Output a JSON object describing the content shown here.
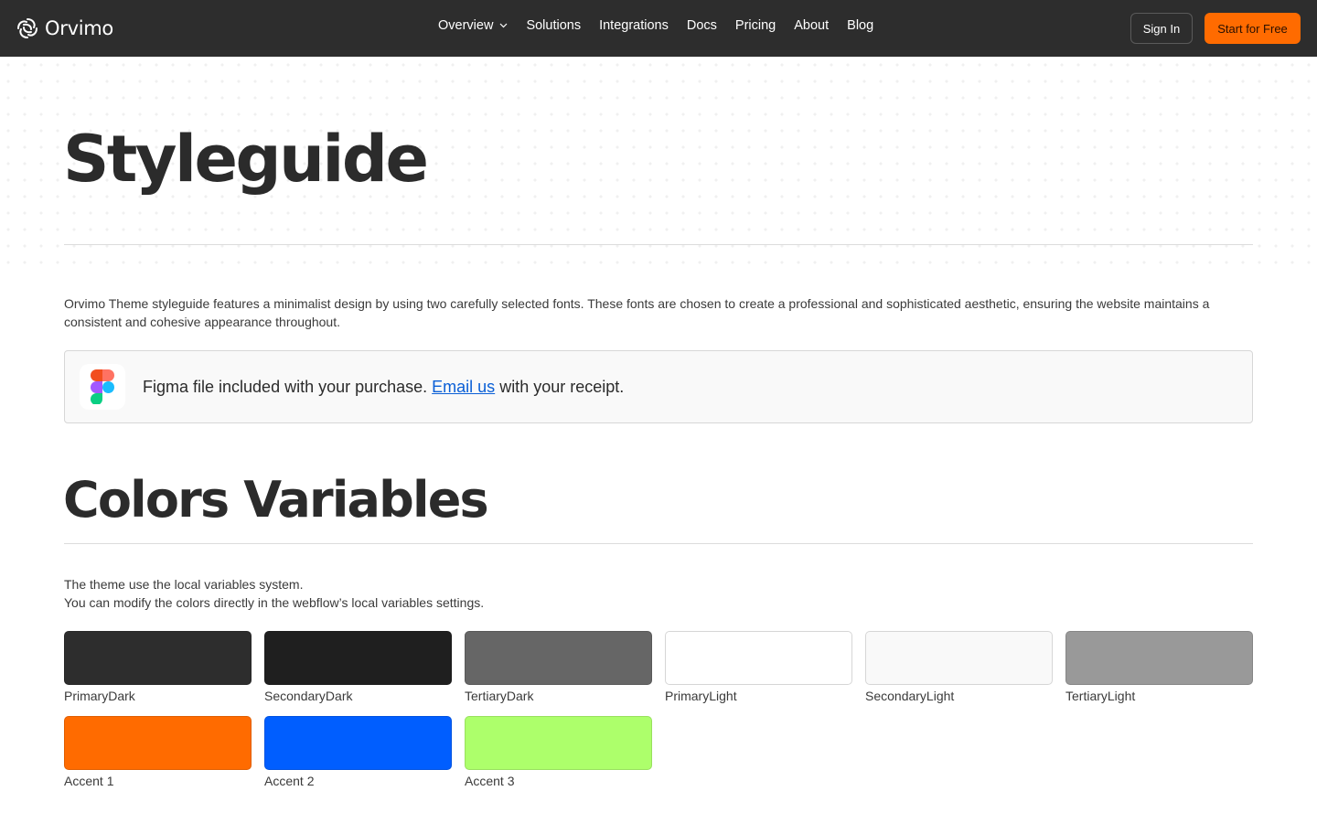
{
  "nav": {
    "brand": "Orvimo",
    "links": [
      "Overview",
      "Solutions",
      "Integrations",
      "Docs",
      "Pricing",
      "About",
      "Blog"
    ],
    "signin": "Sign In",
    "start": "Start for Free"
  },
  "hero": {
    "title": "Styleguide"
  },
  "intro": "Orvimo Theme styleguide features a minimalist design by using two carefully selected fonts. These fonts are chosen to create a professional and sophisticated aesthetic, ensuring the website maintains a consistent and cohesive appearance throughout.",
  "figma": {
    "text_before": "Figma file included with your purchase. ",
    "link": "Email us",
    "text_after": " with your receipt."
  },
  "colors_section": {
    "title": "Colors Variables",
    "desc_line1": "The theme use the local variables system.",
    "desc_line2": "You can modify the colors directly in the webflow’s local variables settings."
  },
  "swatches": [
    {
      "label": "PrimaryDark",
      "color": "#2d2d2d"
    },
    {
      "label": "SecondaryDark",
      "color": "#1f1f1f"
    },
    {
      "label": "TertiaryDark",
      "color": "#666666"
    },
    {
      "label": "PrimaryLight",
      "color": "#ffffff"
    },
    {
      "label": "SecondaryLight",
      "color": "#f9f9f9"
    },
    {
      "label": "TertiaryLight",
      "color": "#999999"
    },
    {
      "label": "Accent 1",
      "color": "#ff6b00"
    },
    {
      "label": "Accent 2",
      "color": "#005eff"
    },
    {
      "label": "Accent 3",
      "color": "#adff6b"
    }
  ],
  "colors": {
    "nav_bg": "#2d2d2d",
    "accent_orange": "#ff6b00",
    "link_blue": "#0a5fd6"
  }
}
